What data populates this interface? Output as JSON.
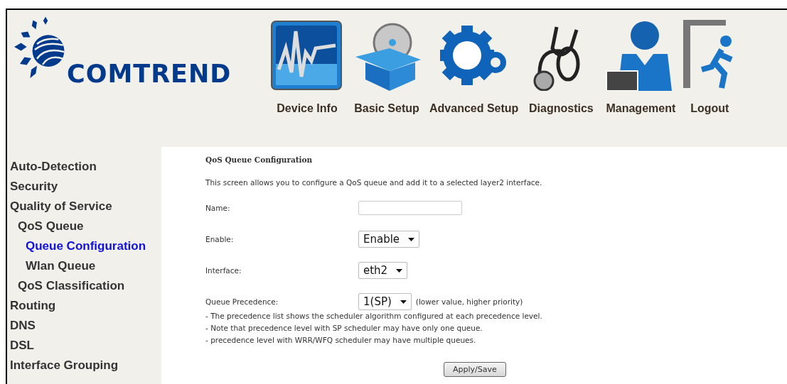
{
  "logo": {
    "text": "COMTREND"
  },
  "nav": [
    {
      "label": "Device Info"
    },
    {
      "label": "Basic Setup"
    },
    {
      "label": "Advanced Setup"
    },
    {
      "label": "Diagnostics"
    },
    {
      "label": "Management"
    },
    {
      "label": "Logout"
    }
  ],
  "sidebar": {
    "items": [
      {
        "label": "Auto-Detection",
        "selected": false
      },
      {
        "label": "Security",
        "selected": false
      },
      {
        "label": "Quality of Service",
        "selected": false,
        "children": [
          {
            "label": "QoS Queue",
            "selected": false,
            "children": [
              {
                "label": "Queue Configuration",
                "selected": true
              },
              {
                "label": "Wlan Queue",
                "selected": false
              }
            ]
          },
          {
            "label": "QoS Classification",
            "selected": false
          }
        ]
      },
      {
        "label": "Routing",
        "selected": false
      },
      {
        "label": "DNS",
        "selected": false
      },
      {
        "label": "DSL",
        "selected": false
      },
      {
        "label": "Interface Grouping",
        "selected": false
      }
    ]
  },
  "page": {
    "title": "QoS Queue Configuration",
    "description": "This screen allows you to configure a QoS queue and add it to a selected layer2 interface.",
    "fields": [
      {
        "kind": "text",
        "label": "Name:"
      },
      {
        "kind": "select",
        "label": "Enable:",
        "value": "Enable"
      },
      {
        "kind": "select",
        "label": "Interface:",
        "value": "eth2"
      },
      {
        "kind": "select",
        "label": "Queue Precedence:",
        "value": "1(SP)",
        "hint": "(lower value, higher priority)"
      }
    ],
    "notes": [
      "- The precedence list shows the scheduler algorithm configured at each precedence level.",
      "- Note that precedence level with SP scheduler may have only one queue.",
      "- precedence level with WRR/WFQ scheduler may have multiple queues."
    ],
    "button": "Apply/Save"
  }
}
